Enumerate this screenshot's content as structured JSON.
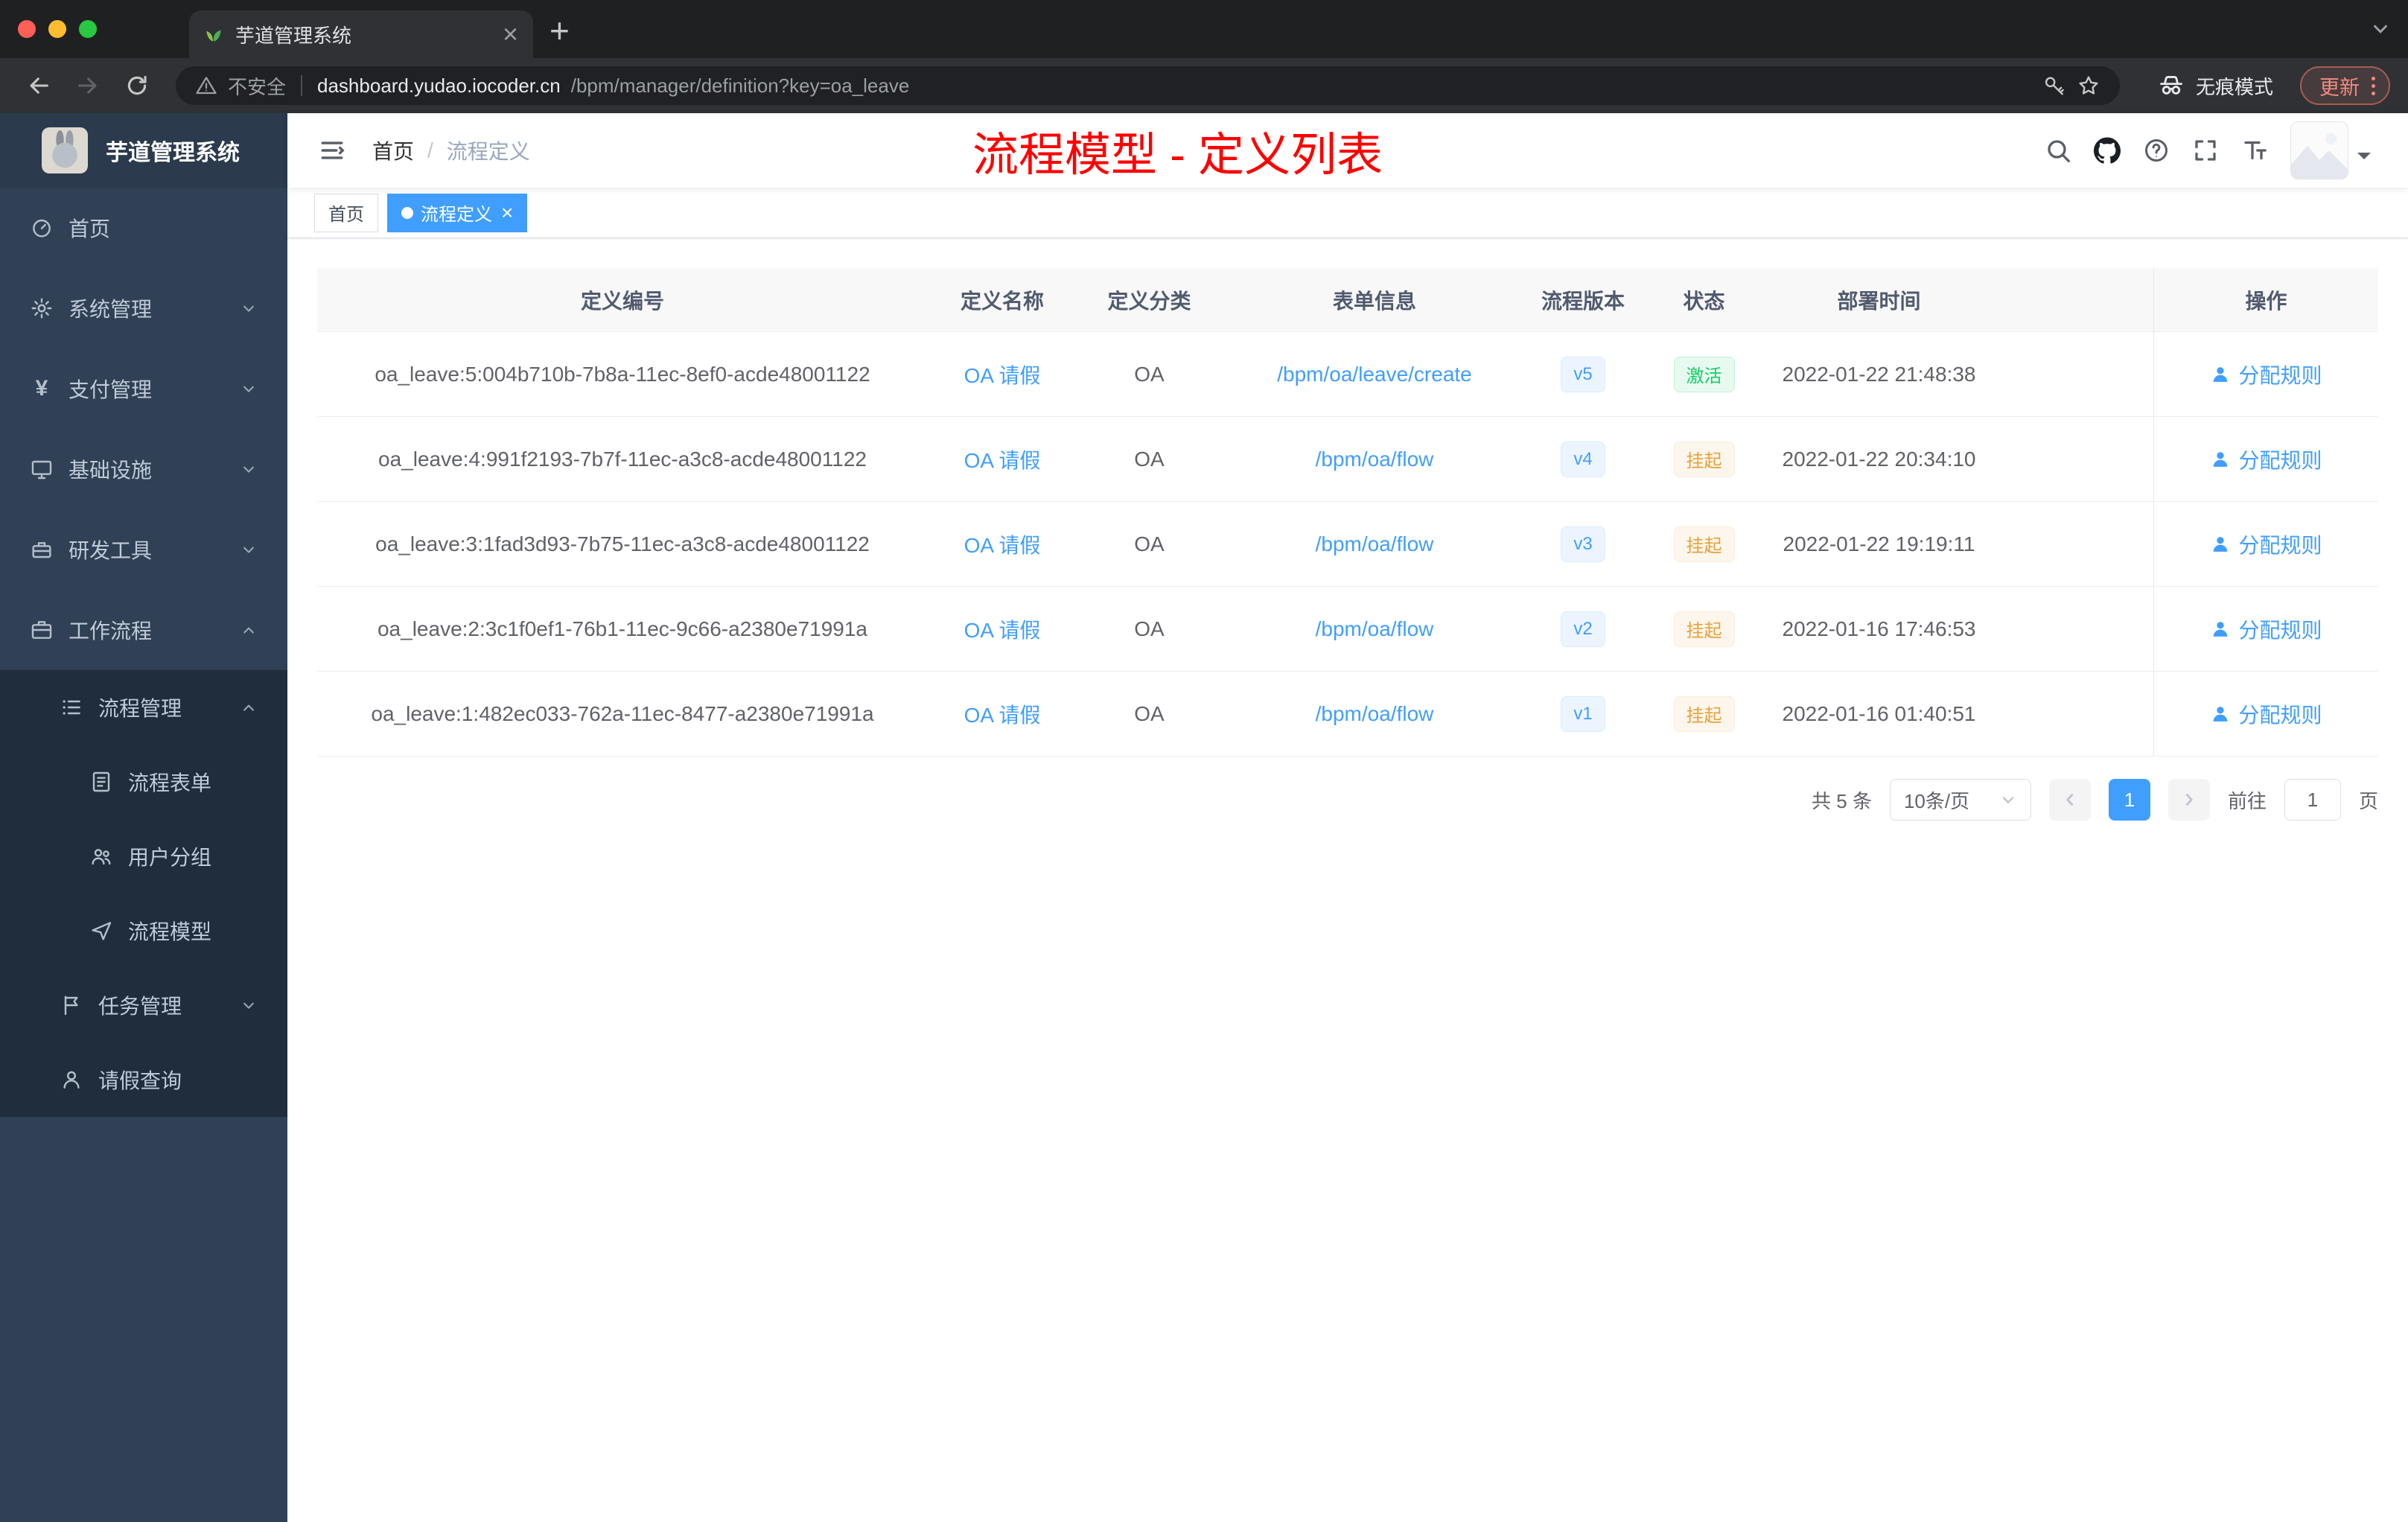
{
  "colors": {
    "accent": "#409eff",
    "success": "#13ce66",
    "warning": "#e6a23c",
    "annotation_red": "#ff0000",
    "sidebar_bg": "#304156",
    "submenu_bg": "#1f2d3d"
  },
  "icons": {
    "close": "×",
    "plus": "+"
  },
  "browser": {
    "tab_title": "芋道管理系统",
    "security_label": "不安全",
    "url_host": "dashboard.yudao.iocoder.cn",
    "url_path": "/bpm/manager/definition?key=oa_leave",
    "incognito_label": "无痕模式",
    "update_label": "更新"
  },
  "sidebar": {
    "logo_title": "芋道管理系统",
    "items": [
      {
        "id": "home",
        "label": "首页",
        "icon": "dashboard-icon",
        "depth": 0
      },
      {
        "id": "system",
        "label": "系统管理",
        "icon": "gear-icon",
        "depth": 0,
        "chevron": "down"
      },
      {
        "id": "payment",
        "label": "支付管理",
        "icon": "yen-icon",
        "depth": 0,
        "chevron": "down"
      },
      {
        "id": "infrastructure",
        "label": "基础设施",
        "icon": "infra-icon",
        "depth": 0,
        "chevron": "down"
      },
      {
        "id": "devtools",
        "label": "研发工具",
        "icon": "tools-icon",
        "depth": 0,
        "chevron": "down"
      },
      {
        "id": "workflow",
        "label": "工作流程",
        "icon": "workflow-icon",
        "depth": 0,
        "chevron": "up"
      },
      {
        "id": "process-manage",
        "label": "流程管理",
        "icon": "process-icon",
        "depth": 1,
        "chevron": "up"
      },
      {
        "id": "process-form",
        "label": "流程表单",
        "icon": "form-icon",
        "depth": 2
      },
      {
        "id": "user-group",
        "label": "用户分组",
        "icon": "group-icon",
        "depth": 2
      },
      {
        "id": "process-model",
        "label": "流程模型",
        "icon": "model-icon",
        "depth": 2
      },
      {
        "id": "task-manage",
        "label": "任务管理",
        "icon": "task-icon",
        "depth": 1,
        "chevron": "down"
      },
      {
        "id": "leave-query",
        "label": "请假查询",
        "icon": "user-icon",
        "depth": 1
      }
    ]
  },
  "header": {
    "breadcrumb_home": "首页",
    "breadcrumb_sep": "/",
    "breadcrumb_current": "流程定义",
    "annotation": "流程模型 - 定义列表"
  },
  "tags": [
    {
      "id": "home",
      "label": "首页",
      "active": false,
      "closable": false
    },
    {
      "id": "process-definition",
      "label": "流程定义",
      "active": true,
      "closable": true
    }
  ],
  "table": {
    "columns": [
      "定义编号",
      "定义名称",
      "定义分类",
      "表单信息",
      "流程版本",
      "状态",
      "部署时间",
      "操作"
    ],
    "action_label": "分配规则",
    "rows": [
      {
        "id": "oa_leave:5:004b710b-7b8a-11ec-8ef0-acde48001122",
        "name": "OA 请假",
        "category": "OA",
        "form": "/bpm/oa/leave/create",
        "version": "v5",
        "status": "激活",
        "status_type": "success",
        "deploy_time": "2022-01-22 21:48:38"
      },
      {
        "id": "oa_leave:4:991f2193-7b7f-11ec-a3c8-acde48001122",
        "name": "OA 请假",
        "category": "OA",
        "form": "/bpm/oa/flow",
        "version": "v4",
        "status": "挂起",
        "status_type": "warning",
        "deploy_time": "2022-01-22 20:34:10"
      },
      {
        "id": "oa_leave:3:1fad3d93-7b75-11ec-a3c8-acde48001122",
        "name": "OA 请假",
        "category": "OA",
        "form": "/bpm/oa/flow",
        "version": "v3",
        "status": "挂起",
        "status_type": "warning",
        "deploy_time": "2022-01-22 19:19:11"
      },
      {
        "id": "oa_leave:2:3c1f0ef1-76b1-11ec-9c66-a2380e71991a",
        "name": "OA 请假",
        "category": "OA",
        "form": "/bpm/oa/flow",
        "version": "v2",
        "status": "挂起",
        "status_type": "warning",
        "deploy_time": "2022-01-16 17:46:53"
      },
      {
        "id": "oa_leave:1:482ec033-762a-11ec-8477-a2380e71991a",
        "name": "OA 请假",
        "category": "OA",
        "form": "/bpm/oa/flow",
        "version": "v1",
        "status": "挂起",
        "status_type": "warning",
        "deploy_time": "2022-01-16 01:40:51"
      }
    ]
  },
  "pagination": {
    "total": "共 5 条",
    "page_size": "10条/页",
    "current_page": "1",
    "goto_label": "前往",
    "goto_value": "1",
    "page_label": "页"
  }
}
